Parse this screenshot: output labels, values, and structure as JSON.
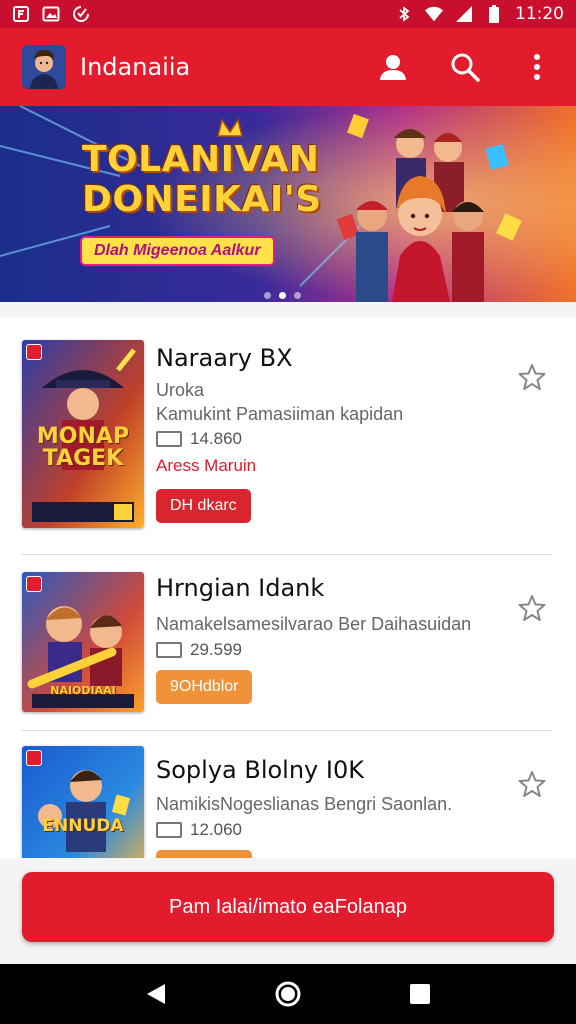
{
  "status_bar": {
    "time": "11:20",
    "left_icons": [
      "notification-icon",
      "image-icon",
      "sync-icon"
    ],
    "right_icons": [
      "bluetooth-icon",
      "wifi-icon",
      "signal-icon",
      "battery-icon"
    ]
  },
  "app_bar": {
    "title": "Indanaiia",
    "actions": [
      "profile-icon",
      "search-icon",
      "more-vert-icon"
    ]
  },
  "banner": {
    "title_line1": "TOLANIVAN",
    "title_line2": "DONEIKAI'S",
    "pill_text": "Dlah Migeenoa Aalkur",
    "page_count": 3,
    "active_page": 1
  },
  "items": [
    {
      "title": "Naraary BX",
      "subtitle": "Uroka",
      "desc": "Kamukint Pamasiiman kapidan",
      "count": "14.860",
      "status": "Aress Maruin",
      "button_label": "DH dkarc",
      "button_color": "#d8252f",
      "cover_text": "MONAP TAGEK"
    },
    {
      "title": "Hrngian Idank",
      "subtitle": "",
      "desc": "Namakelsamesilvarao Ber Daihasuidan",
      "count": "29.599",
      "status": "",
      "button_label": "9OHdblor",
      "button_color": "#f0923a",
      "cover_text": "NAIODIAAI"
    },
    {
      "title": "Soplya Blolny I0K",
      "subtitle": "",
      "desc": "NamikisNogeslianas Bengri Saonlan.",
      "count": "12.060",
      "status": "",
      "button_label": "",
      "button_color": "#f0923a",
      "cover_text": "ENNUDA"
    }
  ],
  "cta": {
    "label": "Pam Ialai/imato eaFolanap"
  },
  "colors": {
    "primary": "#e21b2d",
    "status_bar": "#c8102e",
    "accent_orange": "#f0923a"
  }
}
